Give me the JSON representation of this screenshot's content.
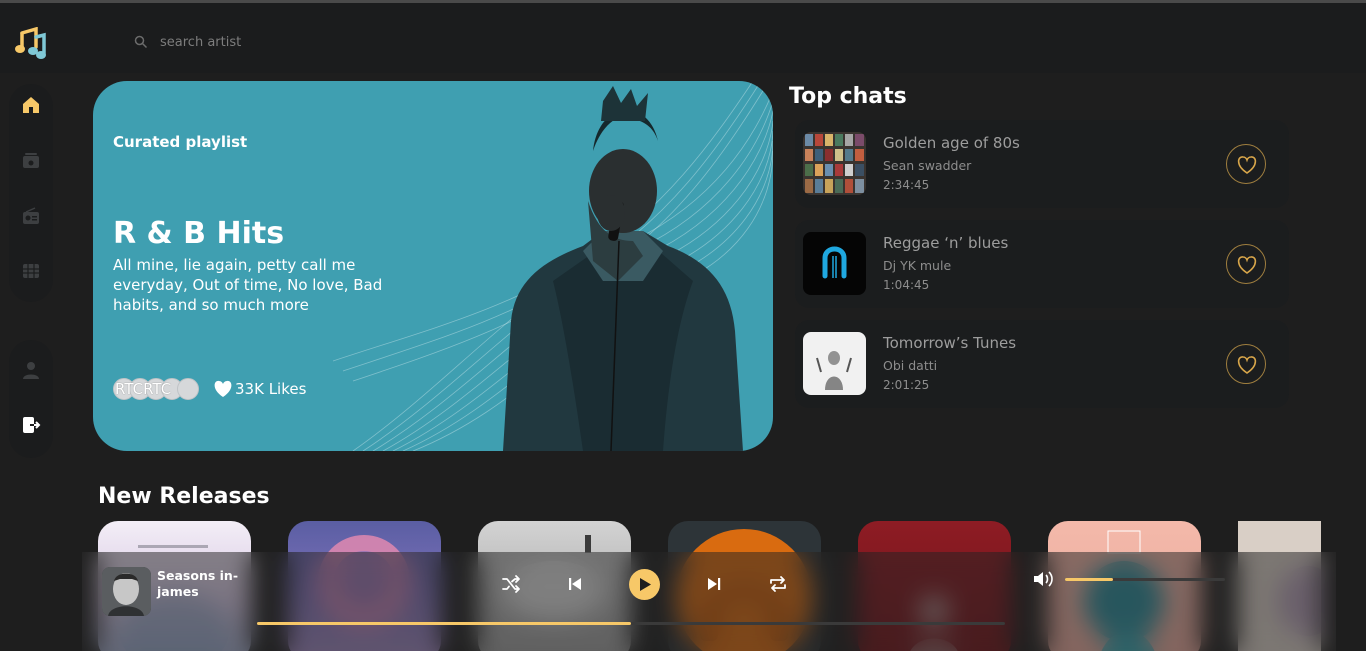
{
  "search": {
    "placeholder": "search artist"
  },
  "sidebar": {
    "items": [
      {
        "icon": "home-icon",
        "active": true
      },
      {
        "icon": "playlist-icon",
        "active": false
      },
      {
        "icon": "radio-icon",
        "active": false
      },
      {
        "icon": "videos-icon",
        "active": false
      },
      {
        "icon": "profile-icon",
        "active": false
      },
      {
        "icon": "logout-icon",
        "active": false
      }
    ]
  },
  "hero": {
    "label": "Curated playlist",
    "title": "R & B Hits",
    "description": "All mine, lie again, petty call me everyday, Out of time, No love, Bad habits, and so much more",
    "avatars_text": "RTCRTC",
    "likes": "33K Likes"
  },
  "top_chats": {
    "title": "Top chats",
    "items": [
      {
        "name": "Golden age of 80s",
        "artist": "Sean swadder",
        "duration": "2:34:45"
      },
      {
        "name": "Reggae ‘n’ blues",
        "artist": "Dj YK mule",
        "duration": "1:04:45"
      },
      {
        "name": "Tomorrow’s Tunes",
        "artist": "Obi datti",
        "duration": "2:01:25"
      }
    ]
  },
  "new_releases": {
    "title": "New Releases"
  },
  "player": {
    "track_title": "Seasons in-james",
    "progress_fraction": 0.5,
    "volume_fraction": 0.3
  },
  "colors": {
    "accent": "#f7c868",
    "hero_bg": "#3f9fb1",
    "background": "#1e1e1e",
    "panel": "#1b1c1d"
  }
}
